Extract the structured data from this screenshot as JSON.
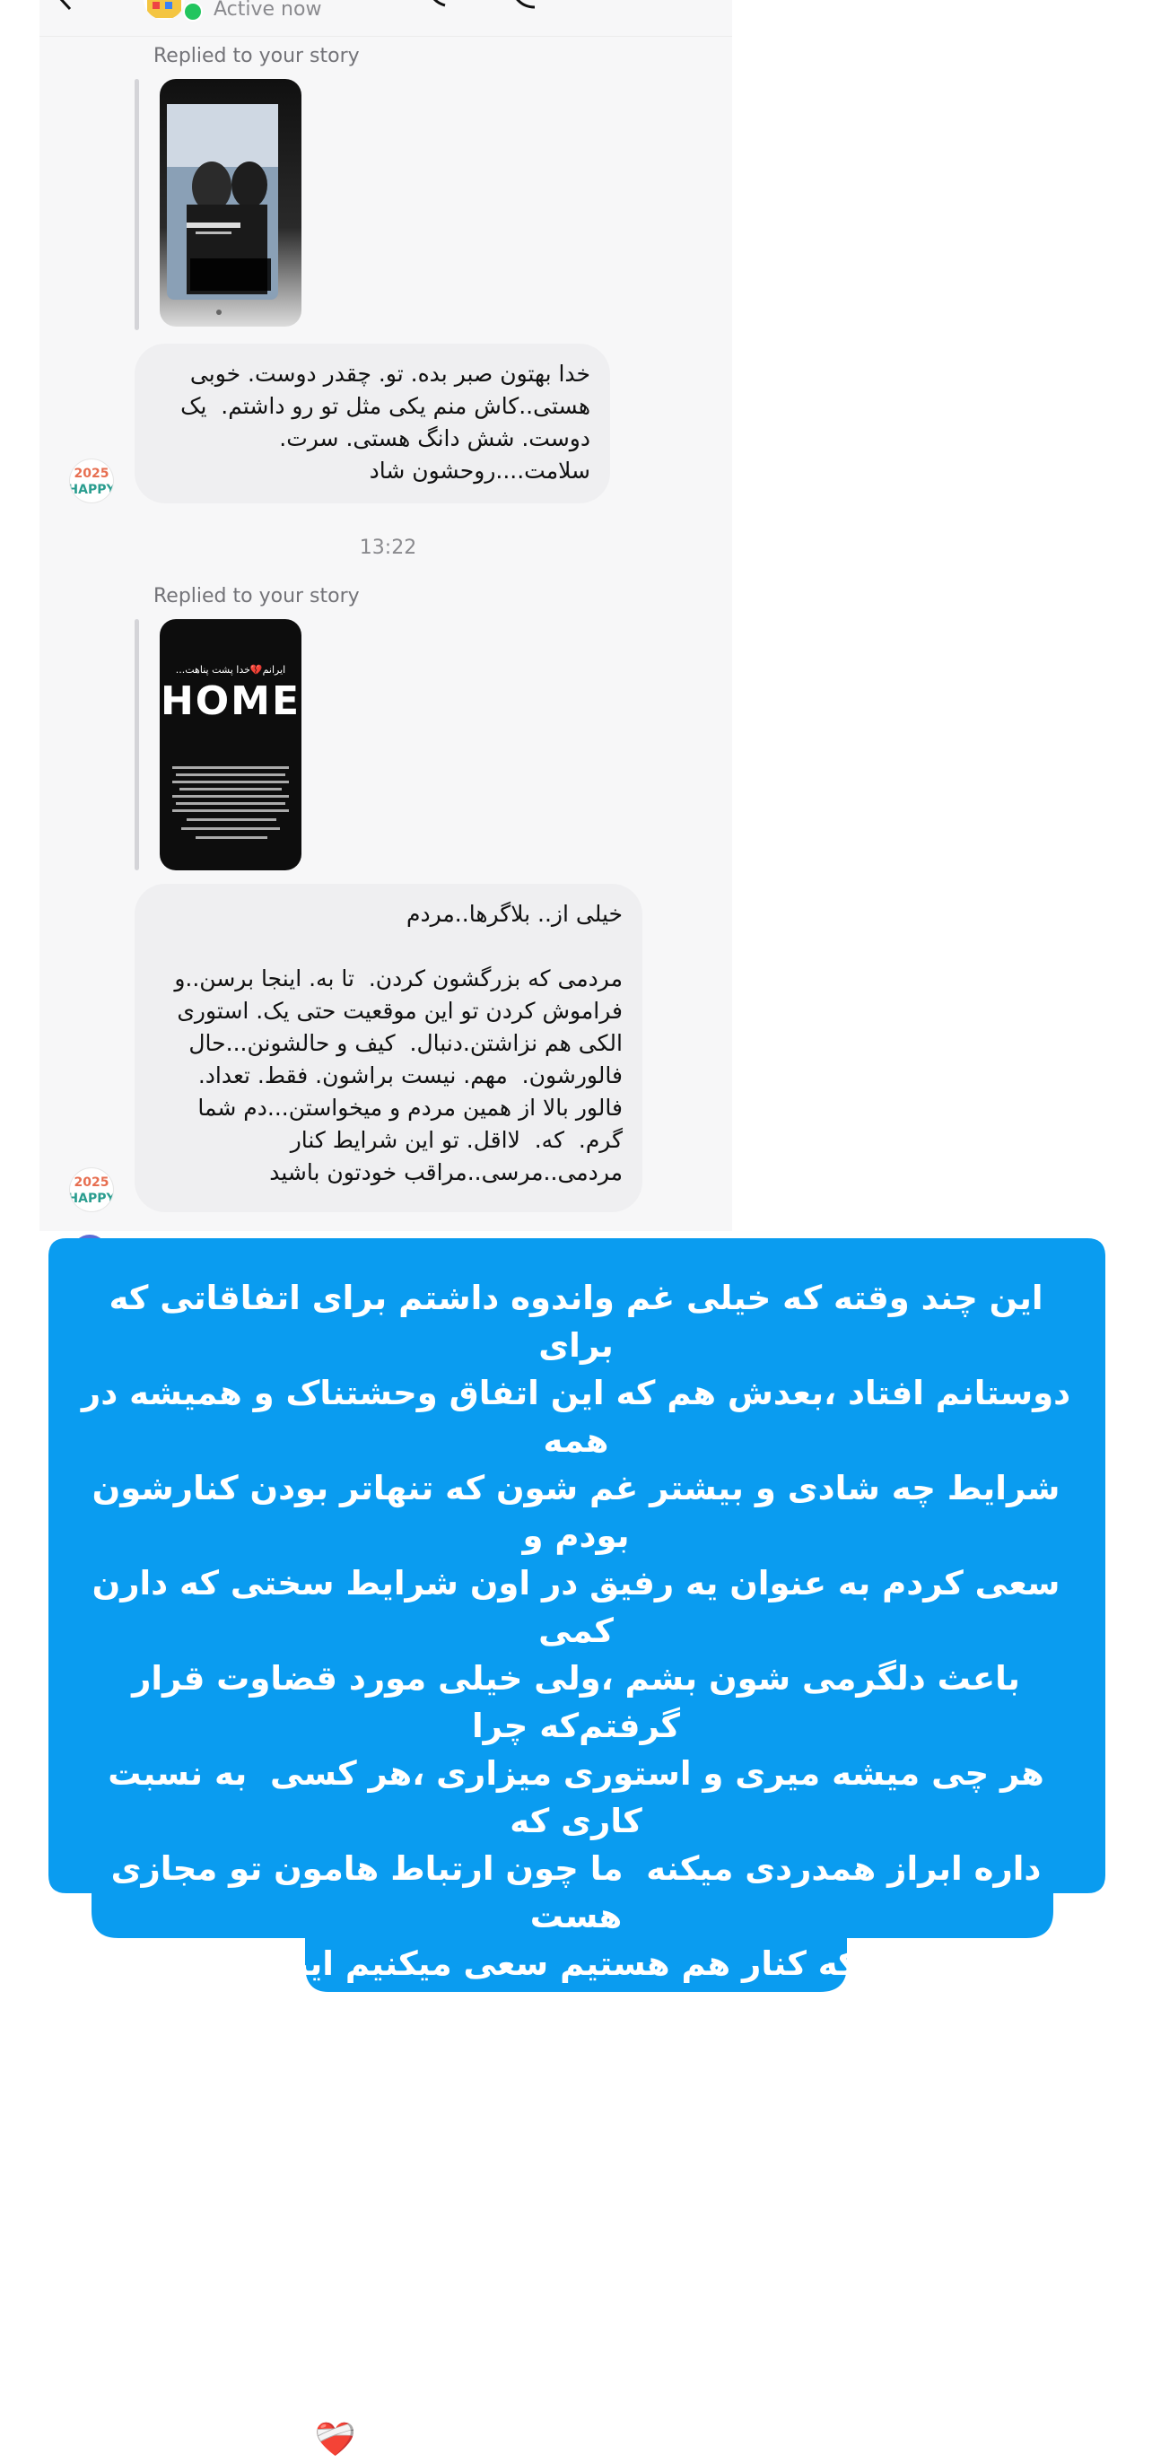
{
  "header": {
    "status": "Active now"
  },
  "messages": [
    {
      "reply_label": "Replied to your story",
      "text": "خدا بهتون صبر بده. تو. چقدر دوست. خوبی\nهستی..کاش منم یکی مثل تو رو داشتم.  یک\nدوست. شش دانگ هستی. سرت.\nسلامت....روحشون شاد"
    },
    {
      "reply_label": "Replied to your story",
      "story_title": "ایرانم💔خدا پشت پناهت...",
      "story_big_text": "HOME",
      "text": "خیلی از.. بلاگرها..مردم\n\nمردمی که بزرگشون کردن.  تا به. اینجا برسن..و\nفراموش کردن تو این موقعیت حتی یک. استوری\nالکی هم نزاشتن.دنبال.  کیف و حالشونن...حال\nفالورشون.  مهم. نیست براشون. فقط. تعداد.\nفالور بالا از همین مردم و میخواستن...دم شما\nگرم.  که.  لااقل. تو این شرایط کنار\nمردمی..مرسی..مراقب خودتون باشید"
    }
  ],
  "timestamp": "13:22",
  "overlay_text": "این چند وقته که خیلی غم واندوه داشتم برای اتفاقاتی که برای\nدوستانم افتاد ،بعدش هم که این اتفاق وحشتناک و همیشه در همه\nشرایط چه شادی و بیشتر غم شون که تنهاتر بودن کنارشون بودم و\nسعی کردم به عنوان یه رفیق در اون شرایط سختی که دارن کمی\nباعث دلگرمی شون بشم ،ولی خیلی مورد قضاوت قرار گرفتم‌که چرا\nهر چی میشه میری و استوری میزاری ،هر کسی  به نسبت کاری که\nداره ابراز همدردی میکنه  ما چون ارتباط هامون تو مجازی هست\nعلاوه بر اینکه کنار هم هستیم سعی میکنیم اینجا هم ابراز همدردی\nکنیم مثل همون چیزی که شما شاید تو پیام های خصوصی با\nدوستاتون دارید ما اینجا میزاریم،وگرنه این تولید محتوا که شما\nمیگید چیزی نیست که مردم دوست داشته باشن وما دوست داشته\nباشیم بزاریم و علاوه بر اینکه فالوری که شما میگید نمیگیریم که\nریزش هم داریم ولی این جزوی از زندگی مون هست ومن فقط\nنمیتونم قسمت خوبش وبزارم❤️‍🩹",
  "colors": {
    "overlay_blue": "#0a9cf0",
    "bubble_gray": "#efeff1",
    "online_green": "#22c55e"
  },
  "icons": [
    "back-icon",
    "call-icon",
    "video-icon",
    "info-icon"
  ]
}
